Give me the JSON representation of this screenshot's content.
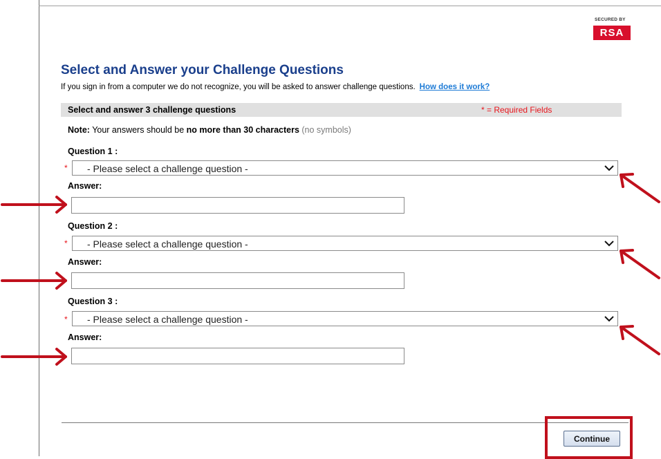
{
  "branding": {
    "secured_by": "SECURED BY",
    "logo_text": "RSA"
  },
  "header": {
    "title": "Select and Answer your Challenge Questions",
    "intro": "If you sign in from a computer we do not recognize, you will be asked to answer challenge questions.",
    "help_link": "How does it work?"
  },
  "section": {
    "label": "Select and answer 3 challenge questions",
    "required_note": "* = Required Fields"
  },
  "note": {
    "prefix": "Note:",
    "text": " Your answers should be ",
    "bold": "no more than 30 characters",
    "suffix": " (no symbols)"
  },
  "required_star": "*",
  "questions": [
    {
      "label": "Question 1 :",
      "selected": "- Please select a challenge question -",
      "answer_label": "Answer:",
      "answer_value": ""
    },
    {
      "label": "Question 2 :",
      "selected": "- Please select a challenge question -",
      "answer_label": "Answer:",
      "answer_value": ""
    },
    {
      "label": "Question 3 :",
      "selected": "- Please select a challenge question -",
      "answer_label": "Answer:",
      "answer_value": ""
    }
  ],
  "actions": {
    "continue_label": "Continue"
  },
  "colors": {
    "title": "#1a3f8c",
    "required": "#e8141b",
    "annotation": "#c0101c",
    "link": "#1e7bd6",
    "rsa": "#d80f2c"
  },
  "icons": {
    "dropdown": "chevron-down-icon",
    "annotation_arrow": "arrow-icon"
  }
}
